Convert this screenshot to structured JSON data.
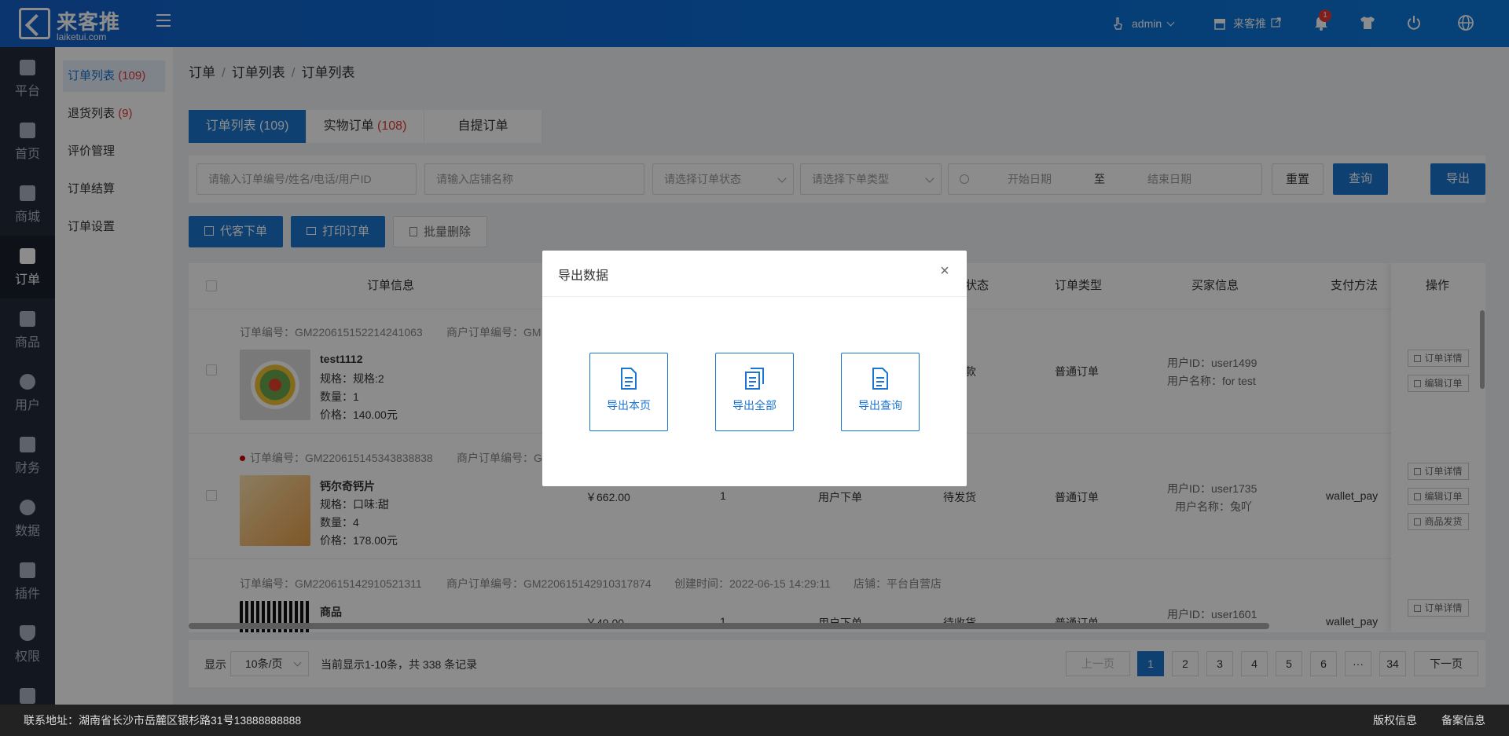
{
  "header": {
    "logo_title": "来客推",
    "logo_sub": "laiketui.com",
    "user": "admin",
    "store": "来客推",
    "notification_count": "1"
  },
  "leftnav": [
    {
      "label": "平台",
      "icon": "platform-icon"
    },
    {
      "label": "首页",
      "icon": "home-icon"
    },
    {
      "label": "商城",
      "icon": "store-icon"
    },
    {
      "label": "订单",
      "icon": "clipboard-icon"
    },
    {
      "label": "商品",
      "icon": "bag-icon"
    },
    {
      "label": "用户",
      "icon": "user-icon"
    },
    {
      "label": "财务",
      "icon": "wallet-icon"
    },
    {
      "label": "数据",
      "icon": "pie-icon"
    },
    {
      "label": "插件",
      "icon": "puzzle-icon"
    },
    {
      "label": "权限",
      "icon": "shield-icon"
    }
  ],
  "subnav": [
    {
      "label": "订单列表",
      "count": "(109)"
    },
    {
      "label": "退货列表",
      "count": "(9)"
    },
    {
      "label": "评价管理",
      "count": ""
    },
    {
      "label": "订单结算",
      "count": ""
    },
    {
      "label": "订单设置",
      "count": ""
    }
  ],
  "breadcrumb": [
    "订单",
    "订单列表",
    "订单列表"
  ],
  "tabs": [
    {
      "label": "订单列表",
      "count": "(109)"
    },
    {
      "label": "实物订单",
      "count": "(108)"
    },
    {
      "label": "自提订单",
      "count": ""
    }
  ],
  "filters": {
    "order_search_placeholder": "请输入订单编号/姓名/电话/用户ID",
    "store_placeholder": "请输入店铺名称",
    "status_placeholder": "请选择订单状态",
    "type_placeholder": "请选择下单类型",
    "start_date": "开始日期",
    "to": "至",
    "end_date": "结束日期",
    "reset": "重置",
    "query": "查询",
    "export": "导出"
  },
  "actions": {
    "proxy_order": "代客下单",
    "print_order": "打印订单",
    "batch_delete": "批量删除"
  },
  "table": {
    "headers": {
      "order_info": "订单信息",
      "status_partial": "状态",
      "order_type": "订单类型",
      "buyer_info": "买家信息",
      "payment": "支付方法",
      "ops": "操作"
    },
    "rows": [
      {
        "order_no": "订单编号：GM220615152214241063",
        "merchant_no": "商户订单编号：GM",
        "name": "test1112",
        "spec": "规格：规格:2",
        "qty": "数量：1",
        "price": "价格：140.00元",
        "amount": "",
        "count": "",
        "source": "",
        "status": "款",
        "type": "普通订单",
        "user_id": "用户ID：user1499",
        "user_name": "用户名称：for test",
        "pay": "",
        "ops": [
          "订单详情",
          "编辑订单"
        ]
      },
      {
        "order_no": "订单编号：GM220615145343838838",
        "merchant_no": "商户订单编号：G",
        "name": "钙尔奇钙片",
        "spec": "规格：口味:甜",
        "qty": "数量：4",
        "price": "价格：178.00元",
        "amount": "￥662.00",
        "count": "1",
        "source": "用户下单",
        "status": "待发货",
        "type": "普通订单",
        "user_id": "用户ID：user1735",
        "user_name": "用户名称：兔吖",
        "pay": "wallet_pay",
        "ops": [
          "订单详情",
          "编辑订单",
          "商品发货"
        ]
      },
      {
        "order_no": "订单编号：GM220615142910521311",
        "merchant_no": "商户订单编号：GM220615142910317874",
        "created": "创建时间：2022-06-15 14:29:11",
        "store": "店铺：平台自营店",
        "name": "商品",
        "amount": "￥49.00",
        "count": "1",
        "source": "用户下单",
        "status": "待收货",
        "type": "普通订单",
        "user_id": "用户ID：user1601",
        "pay": "wallet_pay",
        "ops": [
          "订单详情"
        ]
      }
    ]
  },
  "pager": {
    "show": "显示",
    "page_size": "10条/页",
    "summary": "当前显示1-10条，共 338 条记录",
    "prev": "上一页",
    "pages": [
      "1",
      "2",
      "3",
      "4",
      "5",
      "6",
      "···",
      "34"
    ],
    "next": "下一页"
  },
  "footer": {
    "address": "联系地址：湖南省长沙市岳麓区银杉路31号13888888888",
    "copyright": "版权信息",
    "record": "备案信息"
  },
  "dialog": {
    "title": "导出数据",
    "options": [
      "导出本页",
      "导出全部",
      "导出查询"
    ]
  },
  "colors": {
    "primary": "#1b75d0",
    "danger": "#e53935",
    "sidebar": "#232a3a"
  }
}
